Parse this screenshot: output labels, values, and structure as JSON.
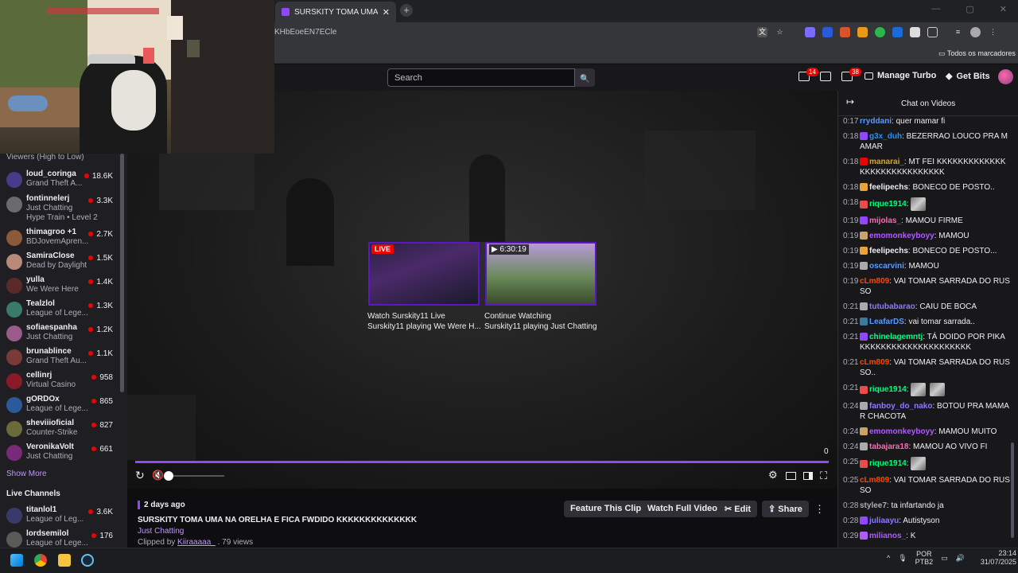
{
  "browser": {
    "tab_title": "SURSKITY TOMA UMA NA ORELHA E FICA FWDIDO KKKKKKKKKKKKKK",
    "tab_close": "✕",
    "new_tab": "+",
    "url": "KHbEoeEN7ECle",
    "bookmarks_label": "Todos os marcadores"
  },
  "topnav": {
    "search_placeholder": "Search",
    "search_icon": "🔍",
    "notifications_count": "14",
    "whispers_count": "38",
    "manage_turbo": "Manage Turbo",
    "get_bits": "Get Bits"
  },
  "sidebar": {
    "sort_label": "Viewers (High to Low)",
    "channels": [
      {
        "name": "loud_coringa",
        "game": "Grand Theft A...",
        "viewers": "18.6K",
        "color": "#4a3a8a"
      },
      {
        "name": "fontinnelerj",
        "game": "Just Chatting",
        "extra": "Hype Train • Level 2",
        "viewers": "3.3K",
        "color": "#6b6b6b"
      },
      {
        "name": "thimagroo +1",
        "game": "BDJovemApren...",
        "viewers": "2.7K",
        "color": "#8a5a3a"
      },
      {
        "name": "SamiraClose",
        "game": "Dead by Daylight",
        "viewers": "1.5K",
        "color": "#b98a7a"
      },
      {
        "name": "yulla",
        "game": "We Were Here",
        "viewers": "1.4K",
        "color": "#5a2a2a"
      },
      {
        "name": "Tealzlol",
        "game": "League of Lege...",
        "viewers": "1.3K",
        "color": "#3a7a6a"
      },
      {
        "name": "sofiaespanha",
        "game": "Just Chatting",
        "viewers": "1.2K",
        "color": "#9a5a8a"
      },
      {
        "name": "brunablince",
        "game": "Grand Theft Au...",
        "viewers": "1.1K",
        "color": "#7a3a3a"
      },
      {
        "name": "cellinrj",
        "game": "Virtual Casino",
        "viewers": "958",
        "color": "#8a1a2a"
      },
      {
        "name": "gORDOx",
        "game": "League of Lege...",
        "viewers": "865",
        "color": "#2a5a9a"
      },
      {
        "name": "sheviiioficial",
        "game": "Counter-Strike",
        "viewers": "827",
        "color": "#6a6a3a"
      },
      {
        "name": "VeronikaVolt",
        "game": "Just Chatting",
        "viewers": "661",
        "color": "#7a2a7a"
      }
    ],
    "show_more": "Show More",
    "live_channels_header": "Live Channels",
    "live_channels": [
      {
        "name": "titanlol1",
        "game": "League of Leg...",
        "viewers": "3.6K",
        "color": "#3a3a6a"
      },
      {
        "name": "lordsemilol",
        "game": "League of Lege...",
        "viewers": "176",
        "color": "#5a5a5a"
      }
    ]
  },
  "video": {
    "live_badge": "LIVE",
    "duration_badge": "▶ 6:30:19",
    "card1_line1": "Watch Surskity11 Live",
    "card1_line2": "Surskity11 playing We Were H...",
    "card2_line1": "Continue Watching",
    "card2_line2": "Surskity11 playing Just Chatting",
    "time_display": "0",
    "progress_fraction": 1.0,
    "volume_fraction": 0.0
  },
  "clip": {
    "age": "2 days ago",
    "title": "SURSKITY TOMA UMA NA ORELHA E FICA FWDIDO KKKKKKKKKKKKKK",
    "category": "Just Chatting",
    "clipped_by_prefix": "Clipped by ",
    "clipper": "Kiiraaaaa_",
    "views": " . 79 views",
    "feature_btn": "Feature This Clip",
    "watch_full_btn": "Watch Full Video",
    "edit_btn": "✂ Edit",
    "share_btn": "⇪ Share",
    "more_btn": "⋮"
  },
  "chat": {
    "title": "Chat on Videos",
    "collapse_icon": "↦",
    "messages": [
      {
        "ts": "0:17",
        "user": "rryddani",
        "color": "#5b9bff",
        "text": ": quer mamar fi",
        "badge": ""
      },
      {
        "ts": "0:18",
        "user": "g3x_duh",
        "color": "#1e90ff",
        "text": ": BEZERRAO LOUCO PRA MAMAR",
        "badge": "#9146ff"
      },
      {
        "ts": "0:18",
        "user": "manarai_",
        "color": "#daa520",
        "text": ": MT FEI KKKKKKKKKKKKKKKKKKKKKKKKKKKKK",
        "badge": "#eb0400"
      },
      {
        "ts": "0:18",
        "user": "feelipechs",
        "color": "#efeff1",
        "text": ": BONECO DE POSTO..",
        "badge": "#e8a33a"
      },
      {
        "ts": "0:18",
        "user": "rique1914",
        "color": "#00ff7f",
        "text": ":",
        "badge": "#eb4b4b",
        "emotes": 1
      },
      {
        "ts": "0:19",
        "user": "mijolas_",
        "color": "#ff69b4",
        "text": ": MAMOU FIRME",
        "badge": "#9146ff"
      },
      {
        "ts": "0:19",
        "user": "emomonkeyboyy",
        "color": "#b05bff",
        "text": ": MAMOU",
        "badge": "#c9a26a"
      },
      {
        "ts": "0:19",
        "user": "feelipechs",
        "color": "#efeff1",
        "text": ": BONECO DE POSTO...",
        "badge": "#e8a33a"
      },
      {
        "ts": "0:19",
        "user": "oscarvini",
        "color": "#5b9bff",
        "text": ": MAMOU",
        "badge": "#aaaaaa"
      },
      {
        "ts": "0:19",
        "user": "cLm809",
        "color": "#ff4500",
        "text": ": VAI TOMAR SARRADA DO RUSSO",
        "badge": ""
      },
      {
        "ts": "0:21",
        "user": "tutubabarao",
        "color": "#8a7bff",
        "text": ": CAIU DE BOCA",
        "badge": "#aaaaaa"
      },
      {
        "ts": "0:21",
        "user": "LeafarDS",
        "color": "#5b9bff",
        "text": ": vai tomar sarrada..",
        "badge": "#3a7a9a"
      },
      {
        "ts": "0:21",
        "user": "chinelagemntj",
        "color": "#00ff7f",
        "text": ": TÁ DOIDO POR PIKA KKKKKKKKKKKKKKKKKKKKK",
        "badge": "#9146ff"
      },
      {
        "ts": "0:21",
        "user": "cLm809",
        "color": "#ff4500",
        "text": ": VAI TOMAR SARRADA DO RUSSO..",
        "badge": ""
      },
      {
        "ts": "0:21",
        "user": "rique1914",
        "color": "#00ff7f",
        "text": ":",
        "badge": "#eb4b4b",
        "emotes": 2
      },
      {
        "ts": "0:24",
        "user": "fanboy_do_nako",
        "color": "#8a7bff",
        "text": ": BOTOU PRA MAMAR CHACOTA",
        "badge": "#aaaaaa"
      },
      {
        "ts": "0:24",
        "user": "emomonkeyboyy",
        "color": "#b05bff",
        "text": ": MAMOU MUITO",
        "badge": "#c9a26a"
      },
      {
        "ts": "0:24",
        "user": "tabajara18",
        "color": "#ff69b4",
        "text": ": MAMOU AO VIVO FI",
        "badge": "#aaaaaa"
      },
      {
        "ts": "0:25",
        "user": "rique1914",
        "color": "#00ff7f",
        "text": ":",
        "badge": "#eb4b4b",
        "emotes": 1
      },
      {
        "ts": "0:25",
        "user": "cLm809",
        "color": "#ff4500",
        "text": ": VAI TOMAR SARRADA DO RUSSO",
        "badge": ""
      },
      {
        "ts": "0:28",
        "user": "stylee7",
        "color": "#adadb8",
        "text": ": ta infartando ja",
        "badge": ""
      },
      {
        "ts": "0:28",
        "user": "juliaayu",
        "color": "#8a7bff",
        "text": ": Autistyson",
        "badge": "#9146ff"
      },
      {
        "ts": "0:29",
        "user": "milianos_",
        "color": "#b05bff",
        "text": ": K",
        "badge": "#b05bff"
      }
    ]
  },
  "taskbar": {
    "lang1": "POR",
    "lang2": "PTB2",
    "time": "23:14",
    "date": "31/07/2025",
    "tray_caret": "^"
  },
  "colors": {
    "accent": "#9146ff",
    "live_red": "#eb0400",
    "chat_bg": "#18181b"
  }
}
